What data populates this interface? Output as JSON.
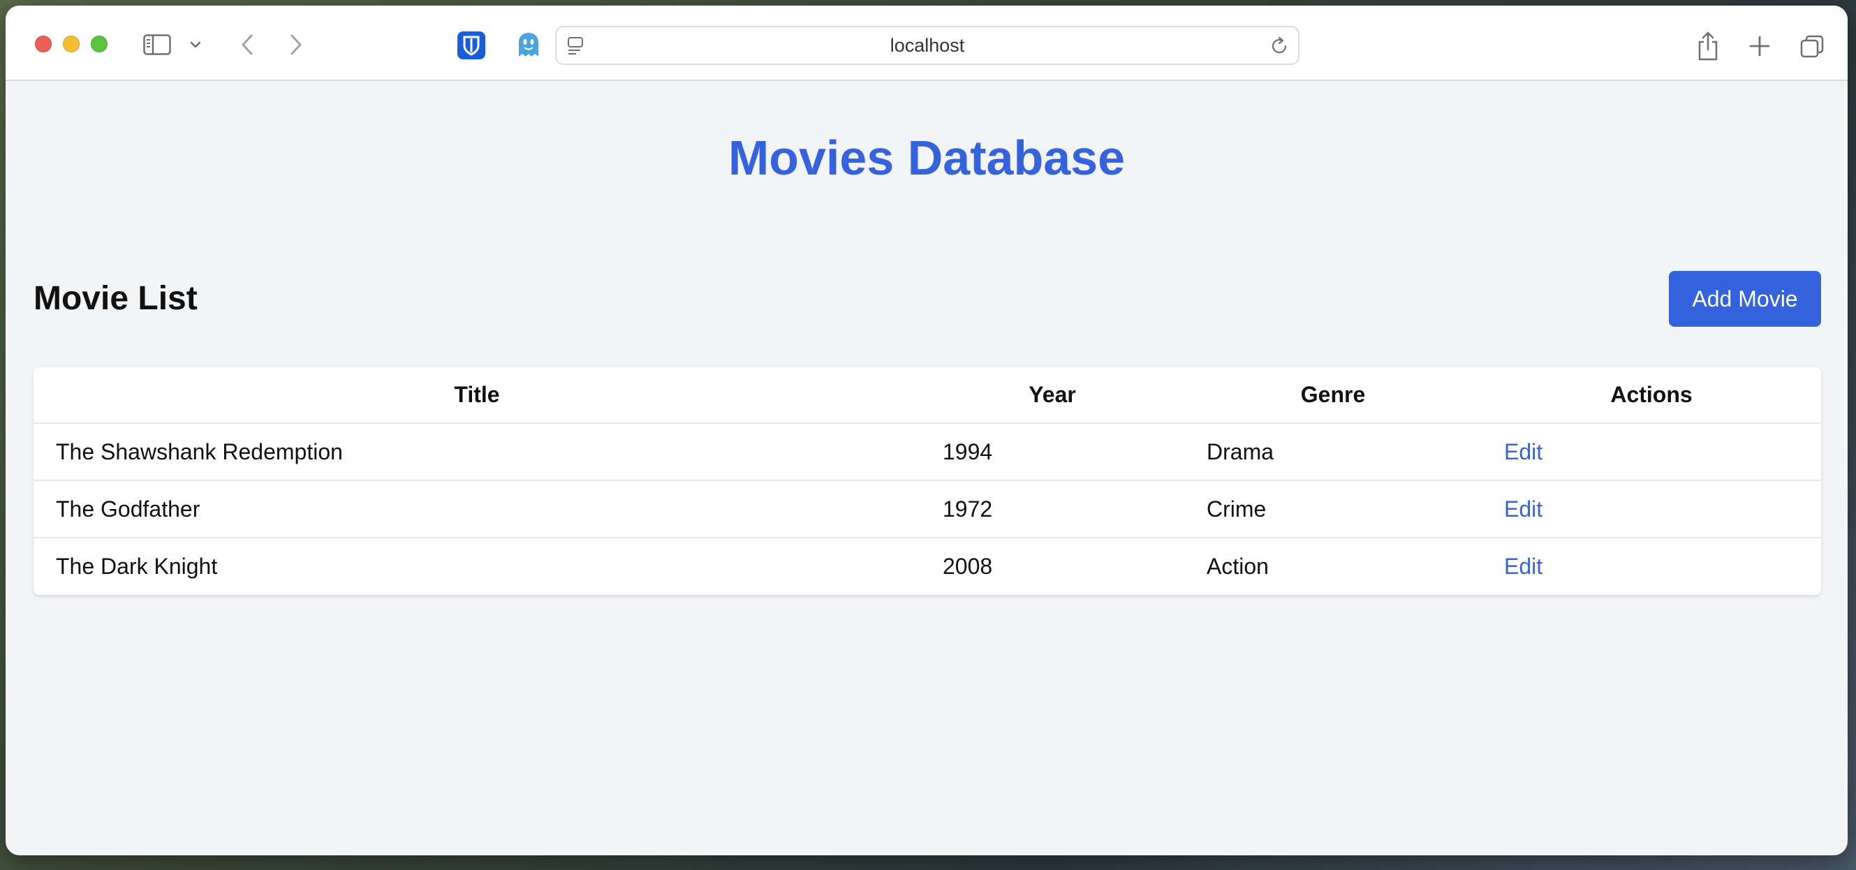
{
  "browser": {
    "url": "localhost",
    "icons": [
      "sidebar-icon",
      "chevron-down-icon",
      "back-arrow-icon",
      "forward-arrow-icon",
      "bitwarden-icon",
      "ghostery-icon",
      "reader-icon",
      "reload-icon",
      "share-icon",
      "plus-icon",
      "tabs-overview-icon"
    ]
  },
  "page": {
    "title": "Movies Database",
    "section_title": "Movie List",
    "add_button": "Add Movie"
  },
  "table": {
    "headers": [
      "Title",
      "Year",
      "Genre",
      "Actions"
    ],
    "rows": [
      {
        "title": "The Shawshank Redemption",
        "year": "1994",
        "genre": "Drama",
        "action": "Edit"
      },
      {
        "title": "The Godfather",
        "year": "1972",
        "genre": "Crime",
        "action": "Edit"
      },
      {
        "title": "The Dark Knight",
        "year": "2008",
        "genre": "Action",
        "action": "Edit"
      }
    ]
  },
  "colors": {
    "accent": "#3563e0",
    "background": "#f3f4f6"
  }
}
